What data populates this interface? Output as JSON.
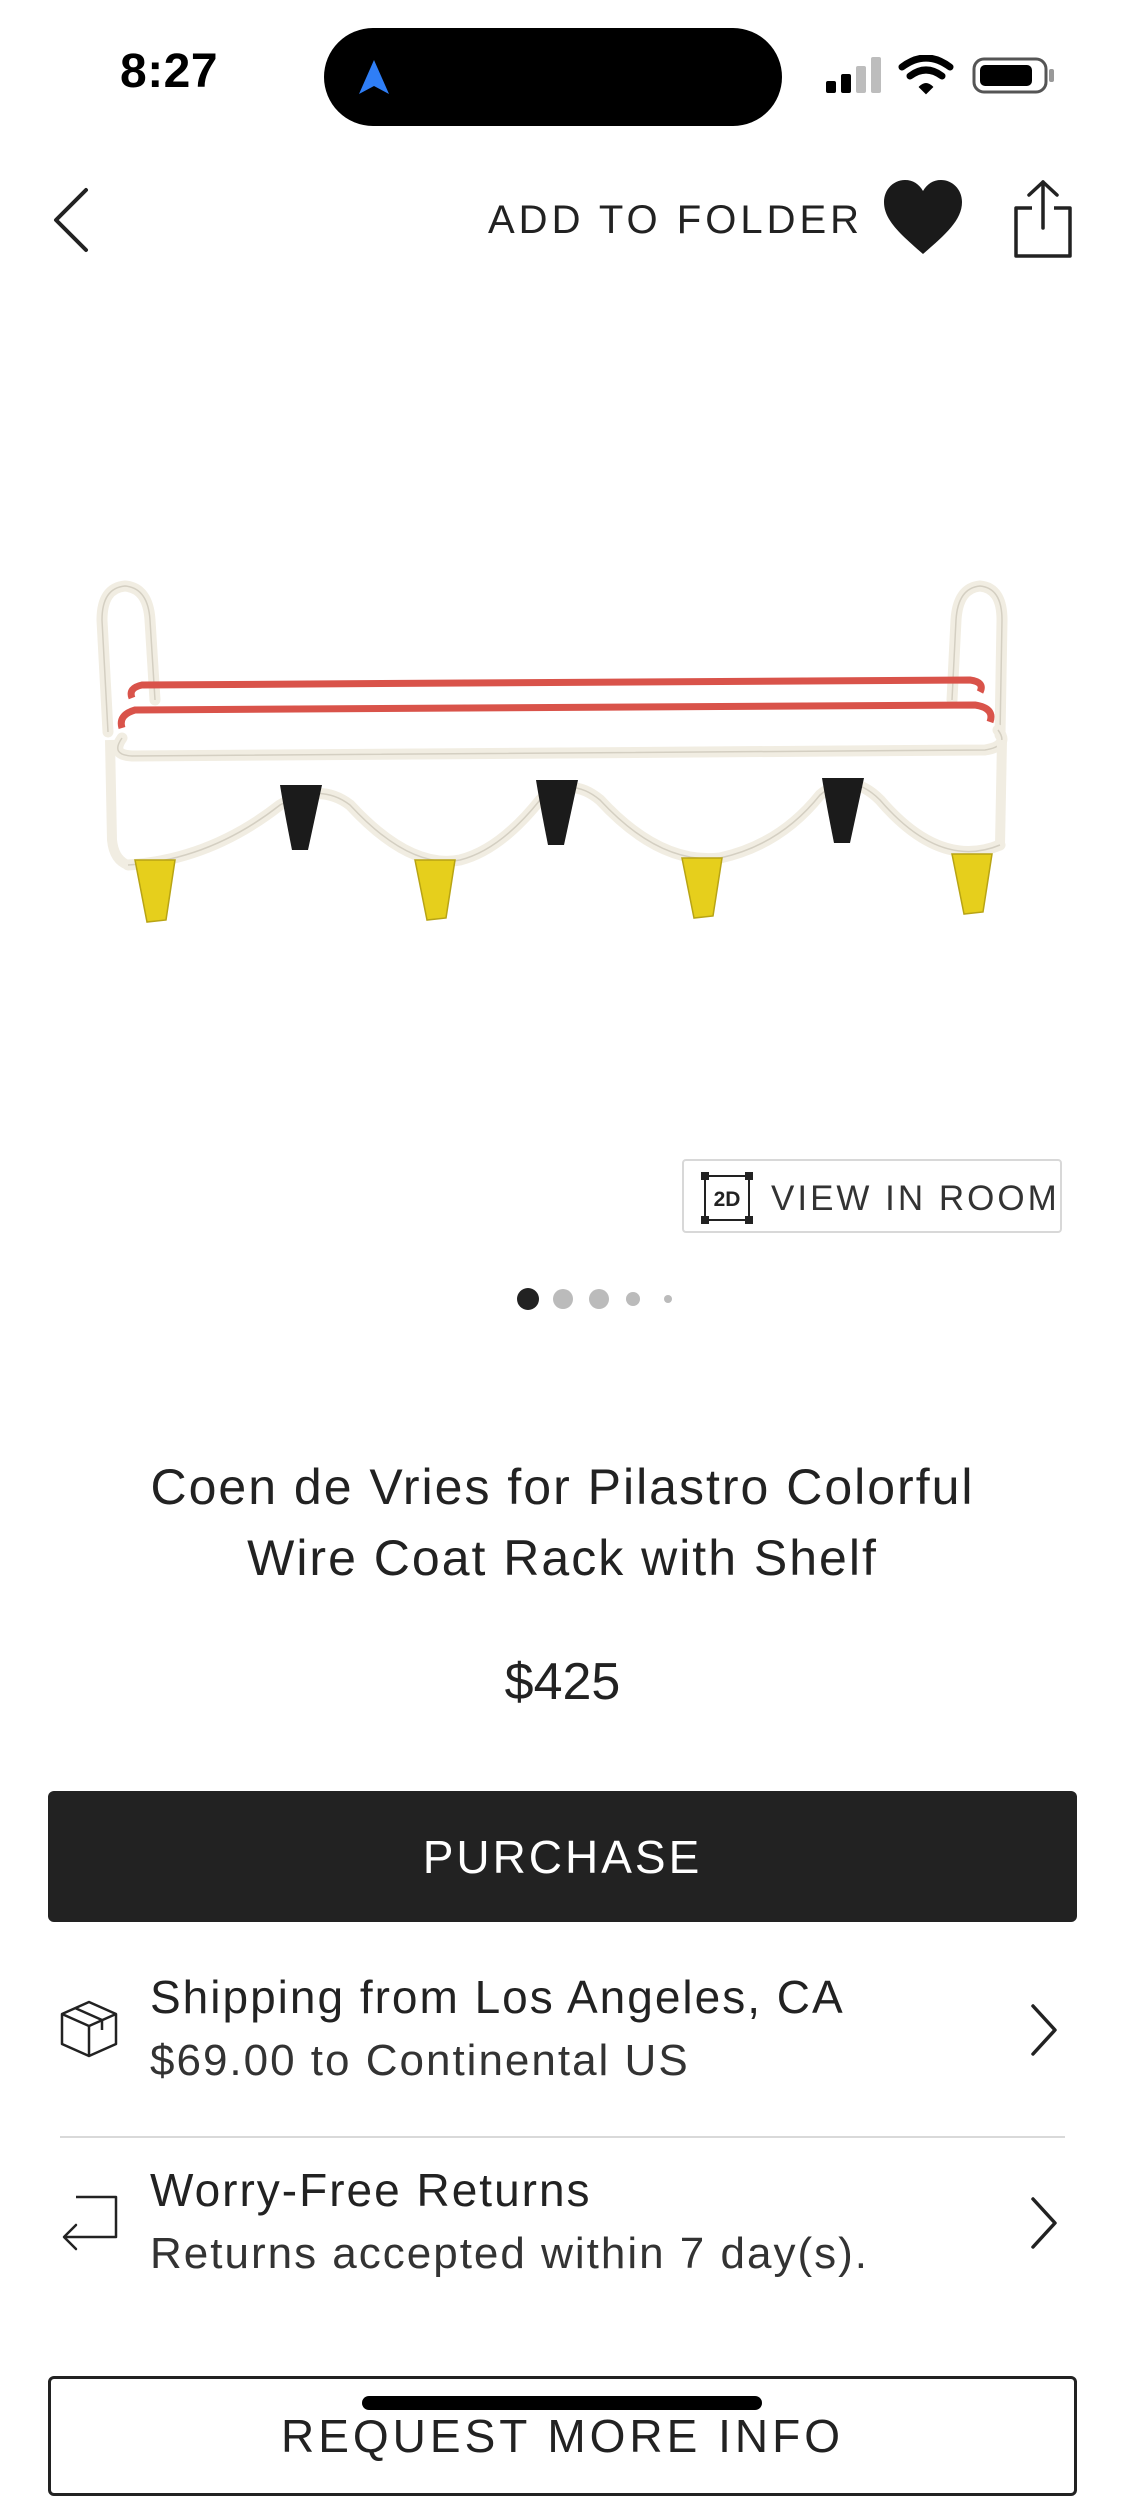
{
  "status_bar": {
    "time": "8:27",
    "icons": [
      "location-arrow-icon",
      "cellular-signal-icon",
      "wifi-icon",
      "battery-icon"
    ],
    "accent_color": "#2f7ef6"
  },
  "header": {
    "back_icon": "chevron-left-icon",
    "add_to_folder_label": "ADD TO FOLDER",
    "favorite_icon": "heart-filled-icon",
    "share_icon": "share-icon"
  },
  "gallery": {
    "view_in_room_badge": "2D",
    "view_in_room_label": "VIEW IN ROOM",
    "current_page": 1,
    "page_count": 5
  },
  "product": {
    "title_line1": "Coen de Vries for Pilastro Colorful",
    "title_line2": "Wire Coat Rack with Shelf",
    "price": "$425",
    "purchase_label": "PURCHASE",
    "shipping": {
      "icon": "package-box-icon",
      "title": "Shipping from Los Angeles, CA",
      "subtitle": "$69.00 to Continental US"
    },
    "returns": {
      "icon": "return-arrow-icon",
      "title": "Worry-Free Returns",
      "subtitle": "Returns accepted within 7 day(s)."
    },
    "request_info_label": "REQUEST MORE INFO"
  },
  "colors": {
    "primary": "#222222",
    "rack_red": "#d9534a",
    "rack_yellow": "#e6cf1c",
    "rack_wire": "#f1ede2"
  }
}
